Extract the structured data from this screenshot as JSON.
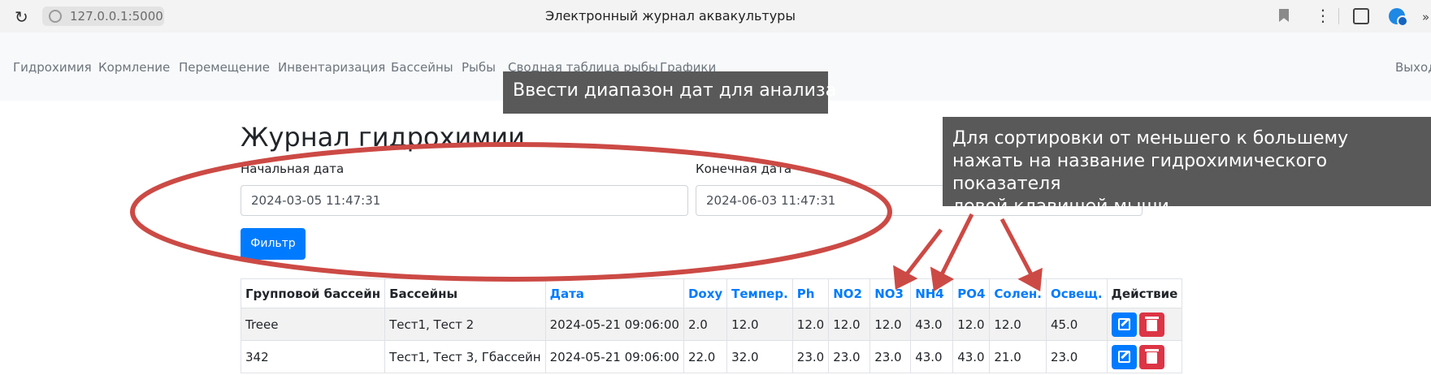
{
  "browser": {
    "url": "127.0.0.1:5000",
    "page_title": "Электронный журнал аквакультуры"
  },
  "nav": {
    "items": [
      "Гидрохимия",
      "Кормление",
      "Перемещение",
      "Инвентаризация",
      "Бассейны",
      "Рыбы",
      "Сводная таблица рыбы",
      "Графики"
    ],
    "exit": "Выход"
  },
  "tooltips": {
    "date_range": "Ввести диапазон дат для анализа",
    "sort_lines": [
      "Для сортировки от меньшего к большему",
      "нажать на название гидрохимического показателя",
      "левой клавишей мыши"
    ]
  },
  "main": {
    "heading": "Журнал гидрохимии",
    "start_label": "Начальная дата",
    "start_value": "2024-03-05 11:47:31",
    "end_label": "Конечная дата",
    "end_value": "2024-06-03 11:47:31",
    "filter_button": "Фильтр"
  },
  "table": {
    "headers": [
      "Групповой бассейн",
      "Бассейны",
      "Дата",
      "Doxy",
      "Темпер.",
      "Ph",
      "NO2",
      "NO3",
      "NH4",
      "PO4",
      "Солен.",
      "Освещ.",
      "Действие"
    ],
    "rows": [
      [
        "Treee",
        "Тест1, Тест 2",
        "2024-05-21 09:06:00",
        "2.0",
        "12.0",
        "12.0",
        "12.0",
        "12.0",
        "43.0",
        "12.0",
        "12.0",
        "45.0"
      ],
      [
        "342",
        "Тест1, Тест 3, Гбассейн",
        "2024-05-21 09:06:00",
        "22.0",
        "32.0",
        "23.0",
        "23.0",
        "23.0",
        "43.0",
        "43.0",
        "21.0",
        "23.0"
      ]
    ]
  },
  "colors": {
    "primary": "#007bff",
    "danger": "#dc3545",
    "annotation_red": "#cc4a45",
    "tooltip_bg": "#595959"
  },
  "icons": {
    "reload": "reload-icon",
    "site_info": "site-info-icon",
    "bookmark": "bookmark-icon",
    "menu": "kebab-menu-icon",
    "edit": "edit-icon",
    "delete": "trash-icon"
  }
}
